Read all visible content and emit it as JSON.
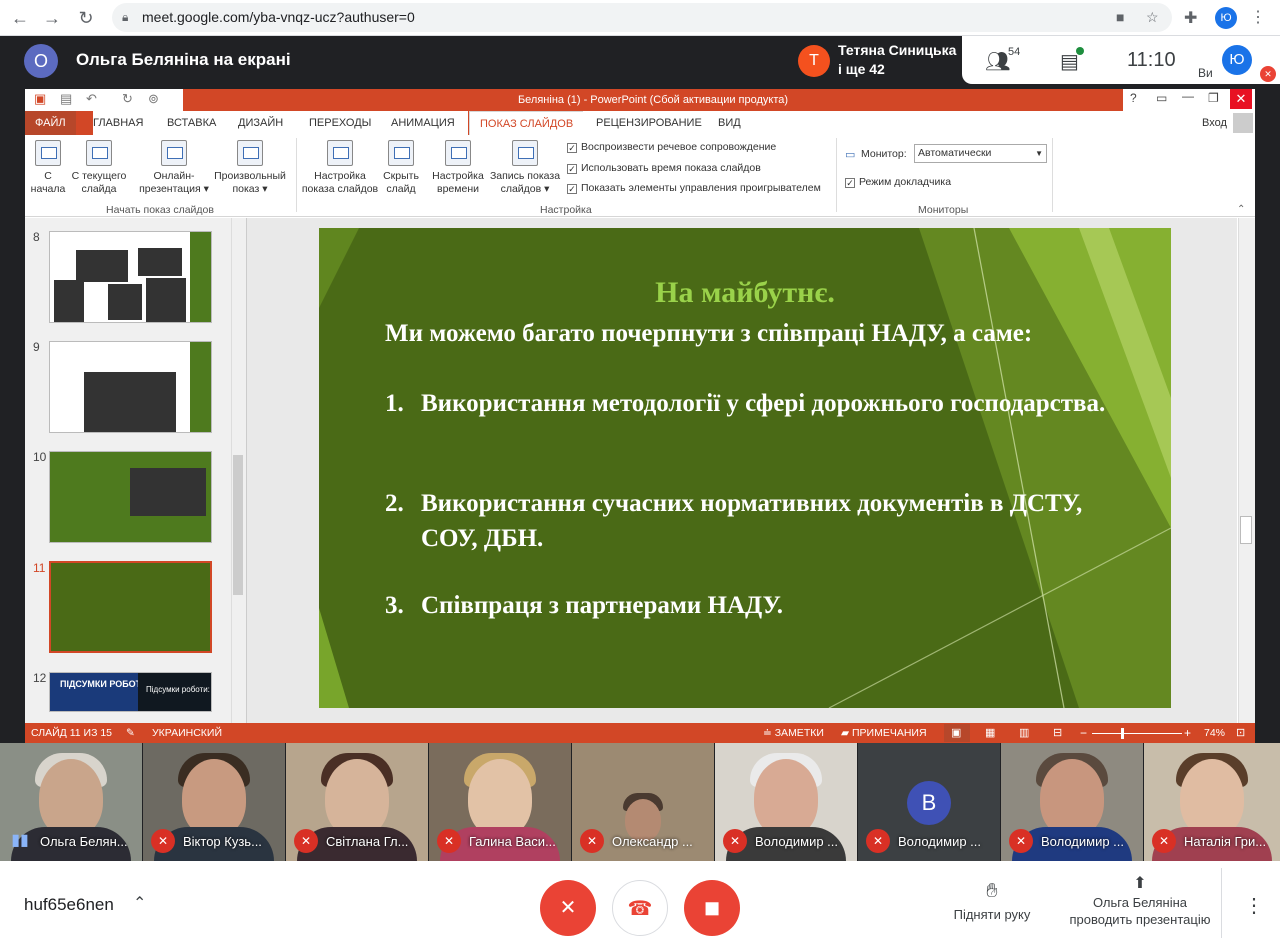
{
  "browser": {
    "url": "meet.google.com/yba-vnqz-ucz?authuser=0",
    "profile_initial": "Ю"
  },
  "meet": {
    "presenter_initial": "О",
    "presenter_title": "Ольга Беляніна на екрані",
    "speaker_initial": "Т",
    "speaker_name": "Тетяна Синицька",
    "speaker_more": "і ще 42",
    "participants_count": "54",
    "time": "11:10",
    "self_initial": "Ю",
    "self_label": "Ви"
  },
  "ppt": {
    "window_title": "Беляніна (1) -  PowerPoint (Сбой активации продукта)",
    "tabs": [
      "ФАЙЛ",
      "ГЛАВНАЯ",
      "ВСТАВКА",
      "ДИЗАЙН",
      "ПЕРЕХОДЫ",
      "АНИМАЦИЯ",
      "ПОКАЗ СЛАЙДОВ",
      "РЕЦЕНЗИРОВАНИЕ",
      "ВИД"
    ],
    "signin": "Вход",
    "ribbon": {
      "from_start": "С начала",
      "from_current": "С текущего слайда",
      "online": "Онлайн-презентация",
      "custom": "Произвольный показ",
      "group1": "Начать показ слайдов",
      "setup": "Настройка показа слайдов",
      "hide": "Скрыть слайд",
      "timings": "Настройка времени",
      "record": "Запись показа слайдов",
      "chk1": "Воспроизвести речевое сопровождение",
      "chk2": "Использовать время показа слайдов",
      "chk3": "Показать элементы управления проигрывателем",
      "group2": "Настройка",
      "monitor_label": "Монитор:",
      "monitor_value": "Автоматически",
      "presenter_view": "Режим докладчика",
      "group3": "Мониторы"
    },
    "thumbs": [
      "8",
      "9",
      "10",
      "11",
      "12"
    ],
    "status": {
      "slide": "СЛАЙД 11 ИЗ 15",
      "lang": "УКРАИНСКИЙ",
      "notes": "ЗАМЕТКИ",
      "comments": "ПРИМЕЧАНИЯ",
      "zoom": "74%"
    }
  },
  "slide": {
    "title": "На майбутнє.",
    "intro": "Ми можемо багато почерпнути з співпраці НАДУ, а саме:",
    "items": [
      {
        "n": "1.",
        "t": "Використання методології у сфері дорожнього господарства."
      },
      {
        "n": "2.",
        "t": "Використання сучасних нормативних документів в ДСТУ, СОУ, ДБН."
      },
      {
        "n": "3.",
        "t": "Співпраця з партнерами НАДУ."
      }
    ]
  },
  "thumb12": {
    "left_text": "ПІДСУМКИ РОБОТИ",
    "right_text": "Підсумки роботи:"
  },
  "participants": [
    {
      "name": "Ольга Белян...",
      "mic": "on"
    },
    {
      "name": "Віктор Кузь...",
      "mic": "off"
    },
    {
      "name": "Світлана Гл...",
      "mic": "off"
    },
    {
      "name": "Галина Васи...",
      "mic": "off"
    },
    {
      "name": "Олександр ...",
      "mic": "off"
    },
    {
      "name": "Володимир ...",
      "mic": "off"
    },
    {
      "name": "Володимир ...",
      "mic": "off",
      "initial": "В"
    },
    {
      "name": "Володимир ...",
      "mic": "off"
    },
    {
      "name": "Наталія Гри...",
      "mic": "off"
    }
  ],
  "bottom": {
    "meeting_code": "huf65e6nen",
    "raise_hand": "Підняти руку",
    "presenting_line1": "Ольга Беляніна",
    "presenting_line2": "проводить презентацію"
  },
  "colors": {
    "ppt_accent": "#d24726",
    "slide_bg": "#4a6a16",
    "slide_title": "#9ad24a",
    "meet_dark": "#202124",
    "danger": "#ea4335"
  }
}
